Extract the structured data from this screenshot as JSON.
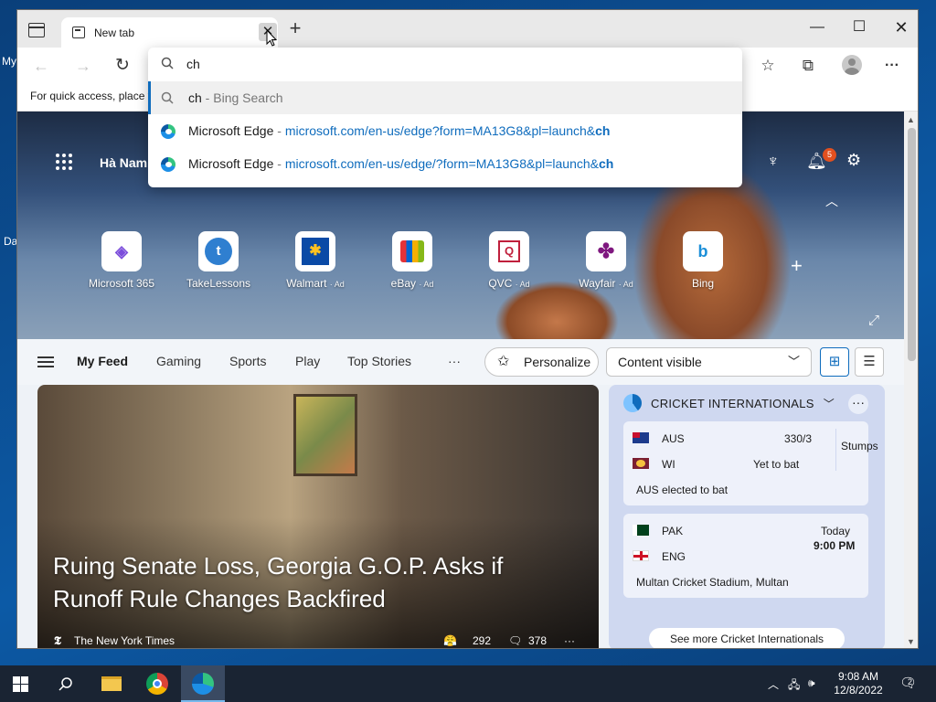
{
  "desktop": {
    "frag1": "My",
    "frag2": "Da"
  },
  "browser": {
    "tab_title": "New tab",
    "close_glyph": "✕",
    "new_tab_glyph": "+",
    "favorites_bar_text": "For quick access, place y"
  },
  "omnibox": {
    "input_value": "ch",
    "suggestions": [
      {
        "title": "ch",
        "separator": " - ",
        "subtitle": "Bing Search"
      },
      {
        "title": "Microsoft Edge",
        "separator": " - ",
        "url_prefix": "microsoft.com/en-us/edge?form=MA13G8&pl=launch&",
        "url_match": "ch"
      },
      {
        "title": "Microsoft Edge",
        "separator": " - ",
        "url_prefix": "microsoft.com/en-us/edge/?form=MA13G8&pl=launch&",
        "url_match": "ch"
      }
    ]
  },
  "hero": {
    "location": "Hà Nam",
    "notification_count": "5",
    "tiles": [
      {
        "label": "Microsoft 365",
        "ad": ""
      },
      {
        "label": "TakeLessons",
        "ad": ""
      },
      {
        "label": "Walmart",
        "ad": "· Ad"
      },
      {
        "label": "eBay",
        "ad": "· Ad"
      },
      {
        "label": "QVC",
        "ad": "· Ad"
      },
      {
        "label": "Wayfair",
        "ad": "· Ad"
      },
      {
        "label": "Bing",
        "ad": ""
      }
    ]
  },
  "feed": {
    "tabs": [
      "My Feed",
      "Gaming",
      "Sports",
      "Play",
      "Top Stories"
    ],
    "more": "···",
    "personalize": "Personalize",
    "content_visible": "Content visible"
  },
  "story": {
    "title": "Ruing Senate Loss, Georgia G.O.P. Asks if Runoff Rule Changes Backfired",
    "source": "The New York Times",
    "reactions": "292",
    "comments": "378"
  },
  "cricket": {
    "title": "CRICKET INTERNATIONALS",
    "match1": {
      "team1": "AUS",
      "score1": "330/3",
      "team2": "WI",
      "score2": "Yet to bat",
      "status": "Stumps",
      "note": "AUS elected to bat"
    },
    "match2": {
      "team1": "PAK",
      "team2": "ENG",
      "day": "Today",
      "time": "9:00 PM",
      "venue": "Multan Cricket Stadium, Multan"
    },
    "see_more": "See more Cricket Internationals"
  },
  "taskbar": {
    "time": "9:08 AM",
    "date": "12/8/2022",
    "notification_count": "2"
  }
}
